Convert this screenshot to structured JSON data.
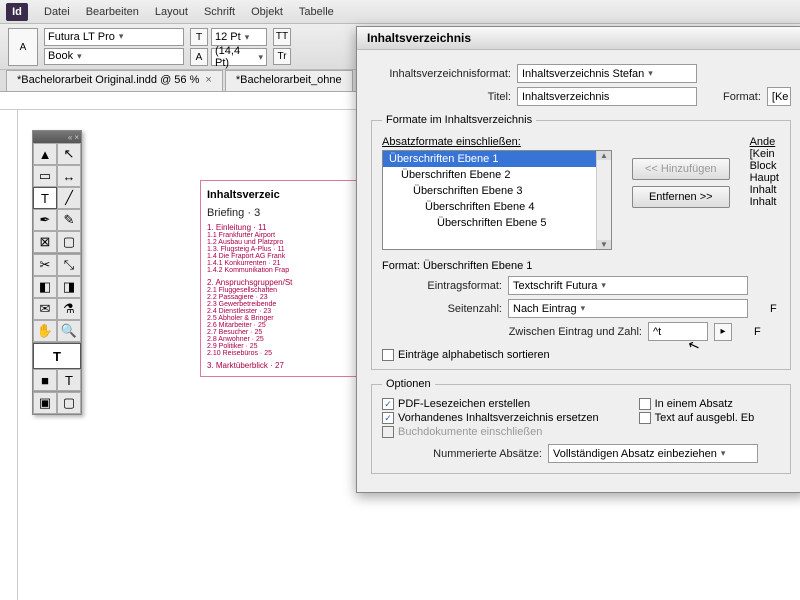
{
  "app": {
    "logo": "Id"
  },
  "menu": [
    "Datei",
    "Bearbeiten",
    "Layout",
    "Schrift",
    "Objekt",
    "Tabelle"
  ],
  "ctrl": {
    "font": "Futura LT Pro",
    "weight": "Book",
    "size": "12 Pt",
    "leading": "(14,4 Pt)",
    "tt": "TT",
    "tr": "Tr"
  },
  "tabs": [
    {
      "label": "*Bachelorarbeit Original.indd @ 56 %"
    },
    {
      "label": "*Bachelorarbeit_ohne"
    }
  ],
  "docprev": {
    "title": "Inhaltsverzeic",
    "briefing": "Briefing",
    "brief_page": "3",
    "sections": [
      "1. Einleitung · 11",
      "1.1 Frankfurter Airport",
      "1.2 Ausbau und Platzpro",
      "1.3. Flugsteig A-Plus · 11",
      "1.4 Die Fraport AG Frank",
      "1.4.1 Konkurrenten · 21",
      "1.4.2 Kommunikation Frap",
      "2. Anspruchsgruppen/St",
      "2.1 Fluggesellschaften",
      "2.2 Passagiere · 23",
      "2.3 Gewerbetreibende",
      "2.4 Dienstleister · 23",
      "2.5 Abholer & Bringer",
      "2.6 Mitarbeiter · 25",
      "2.7 Besucher · 25",
      "2.8 Anwohner · 25",
      "2.9 Politiker · 25",
      "2.10 Reisebüros · 25",
      "3. Marktüberblick · 27"
    ]
  },
  "dialog": {
    "title": "Inhaltsverzeichnis",
    "format_label": "Inhaltsverzeichnisformat:",
    "format_value": "Inhaltsverzeichnis Stefan",
    "title_label": "Titel:",
    "title_value": "Inhaltsverzeichnis",
    "format_field_label": "Format:",
    "format_field_value": "[Ke",
    "group_label": "Formate im Inhaltsverzeichnis",
    "absatz_label": "Absatzformate einschließen:",
    "andere_label": "Ande",
    "list_items": [
      "Überschriften Ebene 1",
      "Überschriften Ebene 2",
      "Überschriften Ebene 3",
      "Überschriften Ebene 4",
      "Überschriften Ebene 5"
    ],
    "other_list": [
      "[Kein",
      "Block",
      "Haupt",
      "Inhalt",
      "Inhalt"
    ],
    "btn_add": "<< Hinzufügen",
    "btn_remove": "Entfernen >>",
    "format_header": "Format: Überschriften Ebene 1",
    "eintragsformat_label": "Eintragsformat:",
    "eintragsformat_value": "Textschrift Futura",
    "seitenzahl_label": "Seitenzahl:",
    "seitenzahl_value": "Nach Eintrag",
    "zwischen_label": "Zwischen Eintrag und Zahl:",
    "zwischen_value": "^t",
    "alpha_sort": "Einträge alphabetisch sortieren",
    "options_label": "Optionen",
    "opt_pdf": "PDF-Lesezeichen erstellen",
    "opt_replace": "Vorhandenes Inhaltsverzeichnis ersetzen",
    "opt_book": "Buchdokumente einschließen",
    "opt_absatz": "In einem Absatz",
    "opt_hidden": "Text auf ausgebl. Eb",
    "num_abs_label": "Nummerierte Absätze:",
    "num_abs_value": "Vollständigen Absatz einbeziehen",
    "side_f": "F",
    "side_f2": "F"
  }
}
